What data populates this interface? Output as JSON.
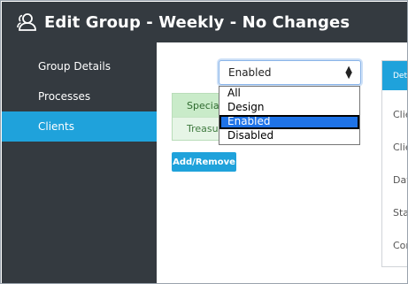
{
  "window": {
    "title": "Edit Group - Weekly - No Changes",
    "title_icon": "user-group-icon"
  },
  "sidebar": {
    "items": [
      {
        "label": "Group Details",
        "active": false
      },
      {
        "label": "Processes",
        "active": false
      },
      {
        "label": "Clients",
        "active": true
      }
    ]
  },
  "filter": {
    "selected": "Enabled",
    "options": [
      "All",
      "Design",
      "Enabled",
      "Disabled"
    ],
    "highlighted_option": "Enabled"
  },
  "clients": {
    "rows": [
      "Special",
      "Treasur"
    ],
    "add_remove_label": "Add/Remove"
  },
  "details": {
    "tab_label": "Deta",
    "labels": [
      "Clie",
      "Clie",
      "Dat",
      "Sta",
      "Cor"
    ]
  },
  "colors": {
    "titlebar": "#343a40",
    "sidebar": "#343a40",
    "accent": "#1fa2db",
    "dropdown_highlight": "#1e73e8"
  }
}
